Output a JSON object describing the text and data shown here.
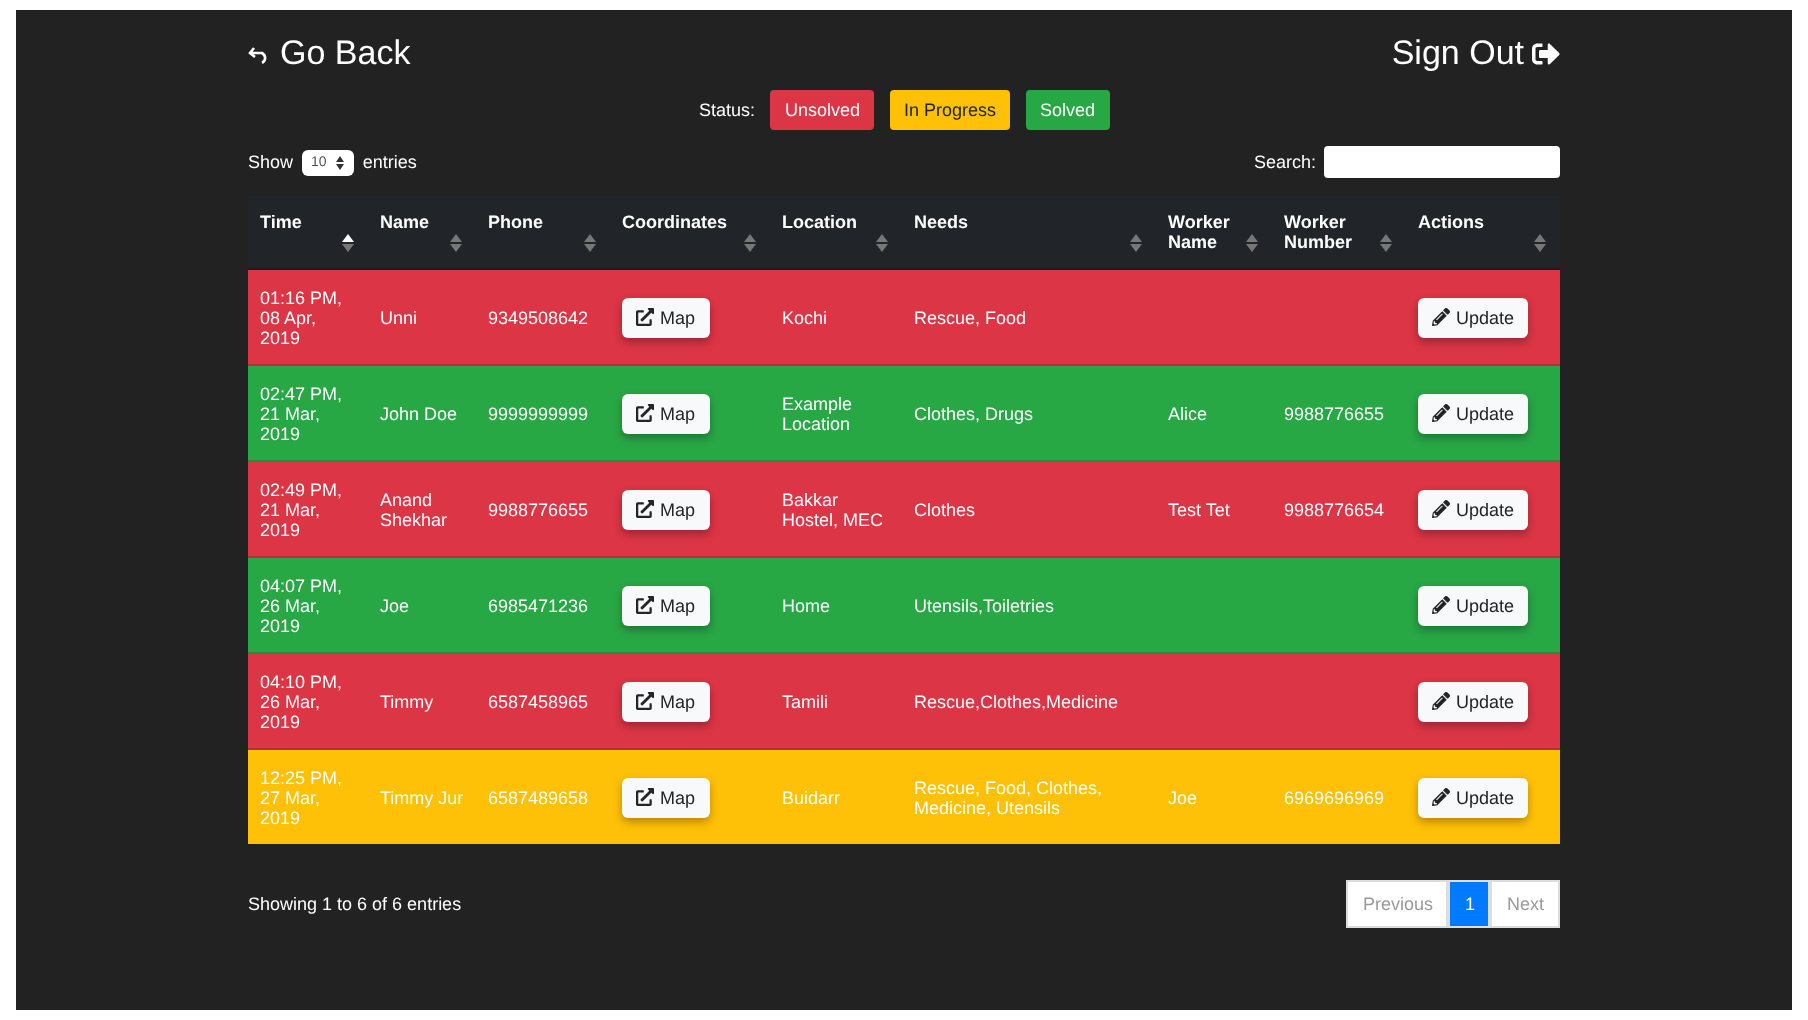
{
  "header": {
    "back": "Go Back",
    "sign_out": "Sign Out"
  },
  "status_legend": {
    "label": "Status:",
    "items": [
      {
        "label": "Unsolved",
        "color": "#dc3545"
      },
      {
        "label": "In Progress",
        "color": "#ffc107"
      },
      {
        "label": "Solved",
        "color": "#28a745"
      }
    ]
  },
  "length_control": {
    "before": "Show",
    "value": "10",
    "after": "entries"
  },
  "search": {
    "label": "Search:"
  },
  "table": {
    "columns": [
      {
        "label": "Time",
        "sorted": true
      },
      {
        "label": "Name",
        "sorted": false
      },
      {
        "label": "Phone",
        "sorted": false
      },
      {
        "label": "Coordinates",
        "sorted": false
      },
      {
        "label": "Location",
        "sorted": false
      },
      {
        "label": "Needs",
        "sorted": false
      },
      {
        "label": "Worker Name",
        "sorted": false
      },
      {
        "label": "Worker Number",
        "sorted": false
      },
      {
        "label": "Actions",
        "sorted": false
      }
    ],
    "rows": [
      {
        "color": "#dc3545",
        "time": "01:16 PM, 08 Apr, 2019",
        "name": "Unni",
        "phone": "9349508642",
        "map": "Map",
        "location": "Kochi",
        "needs": "Rescue, Food",
        "action": "Update"
      },
      {
        "color": "#28a745",
        "time": "02:47 PM, 21 Mar, 2019",
        "name": "John Doe",
        "phone": "9999999999",
        "map": "Map",
        "location": "Example Location",
        "needs": "Clothes, Drugs",
        "worker_name": "Alice",
        "worker_number": "9988776655",
        "action": "Update"
      },
      {
        "color": "#dc3545",
        "time": "02:49 PM, 21 Mar, 2019",
        "name": "Anand Shekhar",
        "phone": "9988776655",
        "map": "Map",
        "location": "Bakkar Hostel, MEC",
        "needs": "Clothes",
        "worker_name": "Test Tet",
        "worker_number": "9988776654",
        "action": "Update"
      },
      {
        "color": "#28a745",
        "time": "04:07 PM, 26 Mar, 2019",
        "name": "Joe",
        "phone": "6985471236",
        "map": "Map",
        "location": "Home",
        "needs": "Utensils,Toiletries",
        "action": "Update"
      },
      {
        "color": "#dc3545",
        "time": "04:10 PM, 26 Mar, 2019",
        "name": "Timmy",
        "phone": "6587458965",
        "map": "Map",
        "location": "Tamili",
        "needs": "Rescue,Clothes,Medicine",
        "action": "Update"
      },
      {
        "color": "#ffc107",
        "time": "12:25 PM, 27 Mar, 2019",
        "name": "Timmy Jur",
        "phone": "6587489658",
        "map": "Map",
        "location": "Buidarr",
        "needs": "Rescue, Food, Clothes, Medicine, Utensils",
        "worker_name": "Joe",
        "worker_number": "6969696969",
        "action": "Update"
      }
    ]
  },
  "info": "Showing 1 to 6 of 6 entries",
  "pagination": {
    "previous": {
      "label": "Previous",
      "disabled": true
    },
    "pages": [
      {
        "label": "1",
        "selected": true
      }
    ],
    "next": {
      "label": "Next",
      "disabled": true
    }
  }
}
